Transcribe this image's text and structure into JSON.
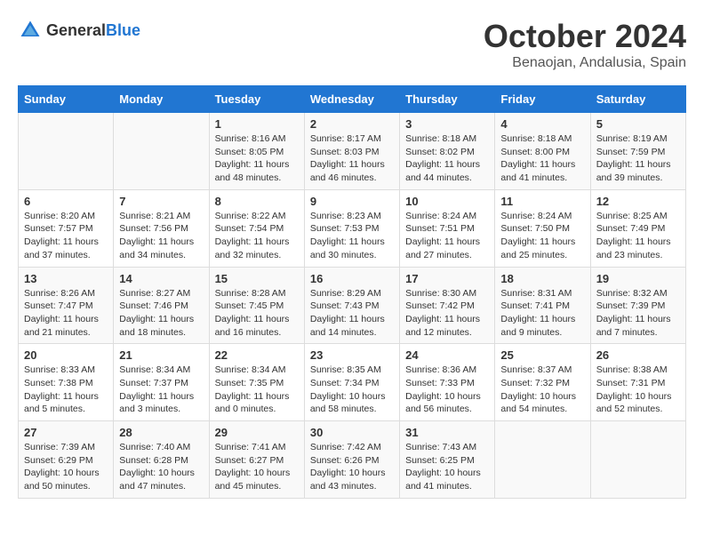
{
  "header": {
    "logo_general": "General",
    "logo_blue": "Blue",
    "month": "October 2024",
    "location": "Benaojan, Andalusia, Spain"
  },
  "days_of_week": [
    "Sunday",
    "Monday",
    "Tuesday",
    "Wednesday",
    "Thursday",
    "Friday",
    "Saturday"
  ],
  "weeks": [
    [
      {
        "day": "",
        "detail": ""
      },
      {
        "day": "",
        "detail": ""
      },
      {
        "day": "1",
        "detail": "Sunrise: 8:16 AM\nSunset: 8:05 PM\nDaylight: 11 hours and 48 minutes."
      },
      {
        "day": "2",
        "detail": "Sunrise: 8:17 AM\nSunset: 8:03 PM\nDaylight: 11 hours and 46 minutes."
      },
      {
        "day": "3",
        "detail": "Sunrise: 8:18 AM\nSunset: 8:02 PM\nDaylight: 11 hours and 44 minutes."
      },
      {
        "day": "4",
        "detail": "Sunrise: 8:18 AM\nSunset: 8:00 PM\nDaylight: 11 hours and 41 minutes."
      },
      {
        "day": "5",
        "detail": "Sunrise: 8:19 AM\nSunset: 7:59 PM\nDaylight: 11 hours and 39 minutes."
      }
    ],
    [
      {
        "day": "6",
        "detail": "Sunrise: 8:20 AM\nSunset: 7:57 PM\nDaylight: 11 hours and 37 minutes."
      },
      {
        "day": "7",
        "detail": "Sunrise: 8:21 AM\nSunset: 7:56 PM\nDaylight: 11 hours and 34 minutes."
      },
      {
        "day": "8",
        "detail": "Sunrise: 8:22 AM\nSunset: 7:54 PM\nDaylight: 11 hours and 32 minutes."
      },
      {
        "day": "9",
        "detail": "Sunrise: 8:23 AM\nSunset: 7:53 PM\nDaylight: 11 hours and 30 minutes."
      },
      {
        "day": "10",
        "detail": "Sunrise: 8:24 AM\nSunset: 7:51 PM\nDaylight: 11 hours and 27 minutes."
      },
      {
        "day": "11",
        "detail": "Sunrise: 8:24 AM\nSunset: 7:50 PM\nDaylight: 11 hours and 25 minutes."
      },
      {
        "day": "12",
        "detail": "Sunrise: 8:25 AM\nSunset: 7:49 PM\nDaylight: 11 hours and 23 minutes."
      }
    ],
    [
      {
        "day": "13",
        "detail": "Sunrise: 8:26 AM\nSunset: 7:47 PM\nDaylight: 11 hours and 21 minutes."
      },
      {
        "day": "14",
        "detail": "Sunrise: 8:27 AM\nSunset: 7:46 PM\nDaylight: 11 hours and 18 minutes."
      },
      {
        "day": "15",
        "detail": "Sunrise: 8:28 AM\nSunset: 7:45 PM\nDaylight: 11 hours and 16 minutes."
      },
      {
        "day": "16",
        "detail": "Sunrise: 8:29 AM\nSunset: 7:43 PM\nDaylight: 11 hours and 14 minutes."
      },
      {
        "day": "17",
        "detail": "Sunrise: 8:30 AM\nSunset: 7:42 PM\nDaylight: 11 hours and 12 minutes."
      },
      {
        "day": "18",
        "detail": "Sunrise: 8:31 AM\nSunset: 7:41 PM\nDaylight: 11 hours and 9 minutes."
      },
      {
        "day": "19",
        "detail": "Sunrise: 8:32 AM\nSunset: 7:39 PM\nDaylight: 11 hours and 7 minutes."
      }
    ],
    [
      {
        "day": "20",
        "detail": "Sunrise: 8:33 AM\nSunset: 7:38 PM\nDaylight: 11 hours and 5 minutes."
      },
      {
        "day": "21",
        "detail": "Sunrise: 8:34 AM\nSunset: 7:37 PM\nDaylight: 11 hours and 3 minutes."
      },
      {
        "day": "22",
        "detail": "Sunrise: 8:34 AM\nSunset: 7:35 PM\nDaylight: 11 hours and 0 minutes."
      },
      {
        "day": "23",
        "detail": "Sunrise: 8:35 AM\nSunset: 7:34 PM\nDaylight: 10 hours and 58 minutes."
      },
      {
        "day": "24",
        "detail": "Sunrise: 8:36 AM\nSunset: 7:33 PM\nDaylight: 10 hours and 56 minutes."
      },
      {
        "day": "25",
        "detail": "Sunrise: 8:37 AM\nSunset: 7:32 PM\nDaylight: 10 hours and 54 minutes."
      },
      {
        "day": "26",
        "detail": "Sunrise: 8:38 AM\nSunset: 7:31 PM\nDaylight: 10 hours and 52 minutes."
      }
    ],
    [
      {
        "day": "27",
        "detail": "Sunrise: 7:39 AM\nSunset: 6:29 PM\nDaylight: 10 hours and 50 minutes."
      },
      {
        "day": "28",
        "detail": "Sunrise: 7:40 AM\nSunset: 6:28 PM\nDaylight: 10 hours and 47 minutes."
      },
      {
        "day": "29",
        "detail": "Sunrise: 7:41 AM\nSunset: 6:27 PM\nDaylight: 10 hours and 45 minutes."
      },
      {
        "day": "30",
        "detail": "Sunrise: 7:42 AM\nSunset: 6:26 PM\nDaylight: 10 hours and 43 minutes."
      },
      {
        "day": "31",
        "detail": "Sunrise: 7:43 AM\nSunset: 6:25 PM\nDaylight: 10 hours and 41 minutes."
      },
      {
        "day": "",
        "detail": ""
      },
      {
        "day": "",
        "detail": ""
      }
    ]
  ]
}
